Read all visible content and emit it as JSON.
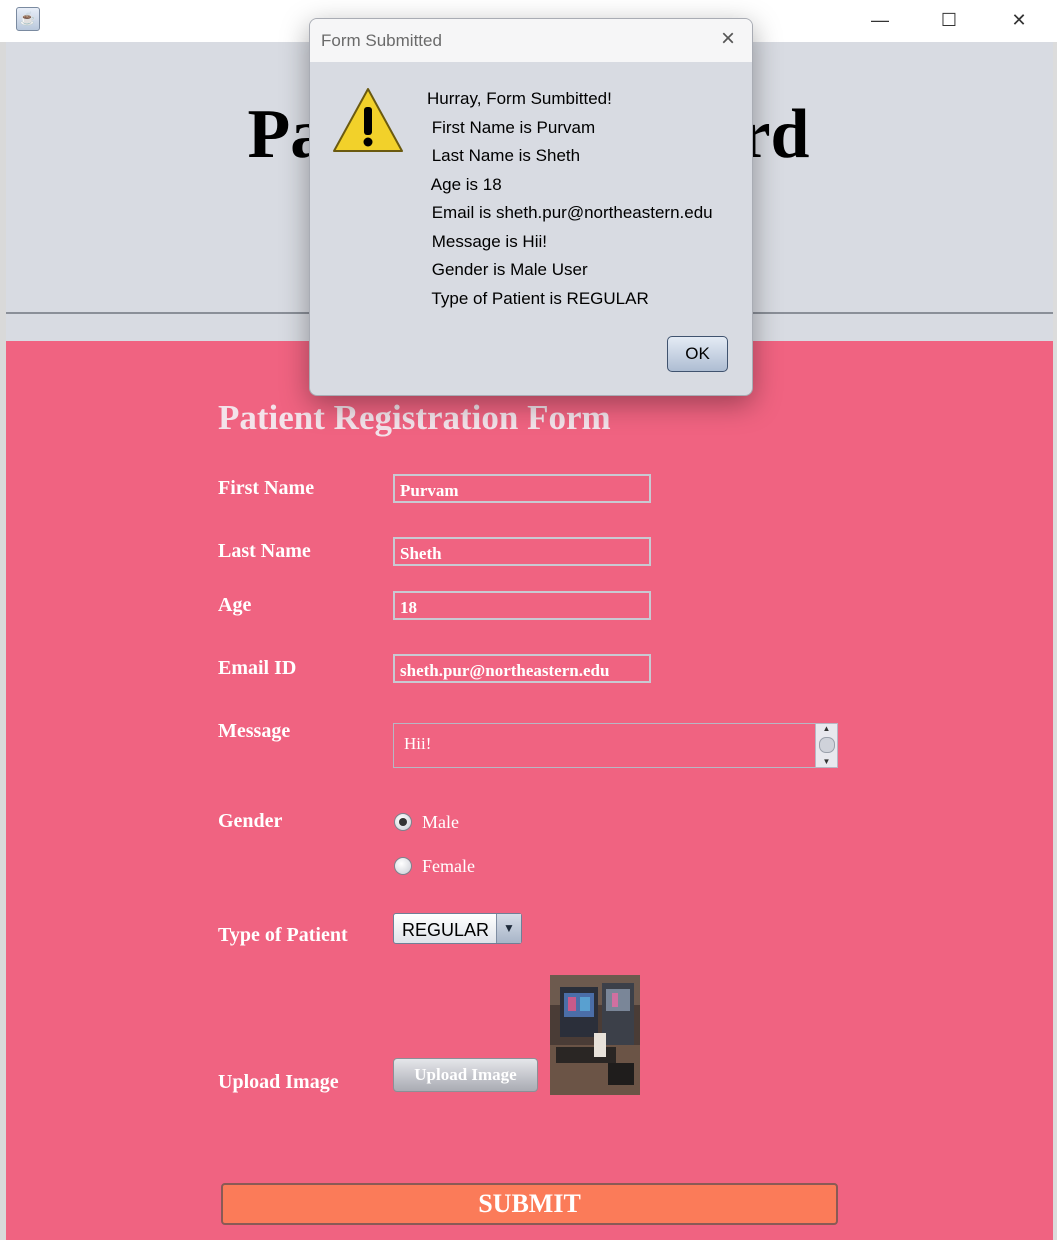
{
  "window": {
    "app_icon": "java-coffee-cup-icon",
    "minimize": "minimize-icon",
    "maximize": "maximize-icon",
    "close": "close-icon"
  },
  "header": {
    "title": "Patient Dashboard"
  },
  "form": {
    "title": "Patient Registration Form",
    "first_name_label": "First Name",
    "first_name_value": "Purvam",
    "last_name_label": "Last Name",
    "last_name_value": "Sheth",
    "age_label": "Age",
    "age_value": "18",
    "email_label": "Email ID",
    "email_value": "sheth.pur@northeastern.edu",
    "message_label": "Message",
    "message_value": "Hii!",
    "gender_label": "Gender",
    "gender_options": [
      {
        "label": "Male",
        "selected": true
      },
      {
        "label": "Female",
        "selected": false
      }
    ],
    "patient_type_label": "Type of Patient",
    "patient_type_value": "REGULAR",
    "upload_label": "Upload Image",
    "upload_button": "Upload Image",
    "submit_button": "SUBMIT"
  },
  "dialog": {
    "title": "Form Submitted",
    "icon": "warning-icon",
    "lines": [
      "Hurray, Form Sumbitted!",
      " First Name is Purvam",
      " Last Name is Sheth",
      " Age is 18",
      " Email is sheth.pur@northeastern.edu",
      " Message is Hii!",
      " Gender is Male User",
      " Type of Patient is REGULAR"
    ],
    "ok_button": "OK"
  },
  "colors": {
    "form_bg": "#f06381",
    "header_bg": "#d8dbe2",
    "submit_bg": "#fb7b59"
  }
}
